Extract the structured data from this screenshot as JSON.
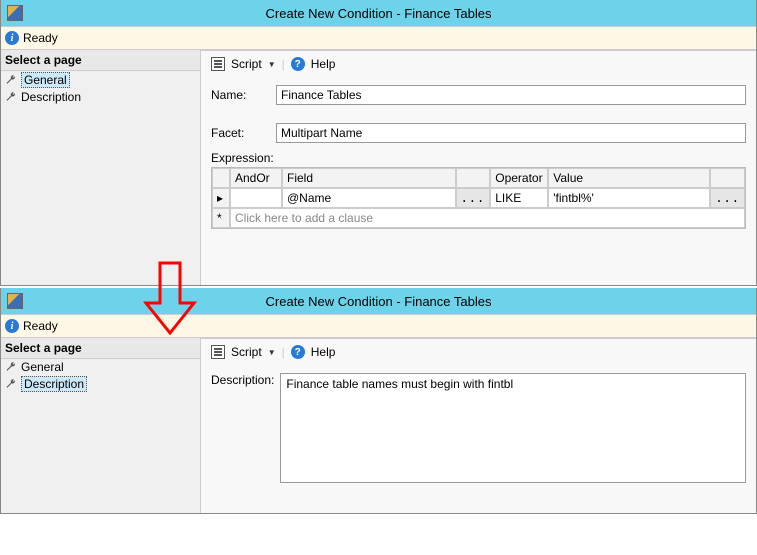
{
  "window1": {
    "title": "Create New Condition - Finance Tables",
    "status": "Ready",
    "sidebar": {
      "header": "Select a page",
      "items": [
        {
          "label": "General",
          "selected": true
        },
        {
          "label": "Description",
          "selected": false
        }
      ]
    },
    "toolbar": {
      "script": "Script",
      "help": "Help"
    },
    "form": {
      "name_label": "Name:",
      "name_value": "Finance Tables",
      "facet_label": "Facet:",
      "facet_value": "Multipart Name",
      "expression_label": "Expression:"
    },
    "grid": {
      "headers": {
        "andor": "AndOr",
        "field": "Field",
        "operator": "Operator",
        "value": "Value"
      },
      "row": {
        "field": "@Name",
        "operator": "LIKE",
        "value": "'fintbl%'"
      },
      "hint": "Click here to add a clause"
    }
  },
  "window2": {
    "title": "Create New Condition - Finance Tables",
    "status": "Ready",
    "sidebar": {
      "header": "Select a page",
      "items": [
        {
          "label": "General",
          "selected": false
        },
        {
          "label": "Description",
          "selected": true
        }
      ]
    },
    "toolbar": {
      "script": "Script",
      "help": "Help"
    },
    "form": {
      "description_label": "Description:",
      "description_value": "Finance table names must begin with fintbl"
    }
  }
}
